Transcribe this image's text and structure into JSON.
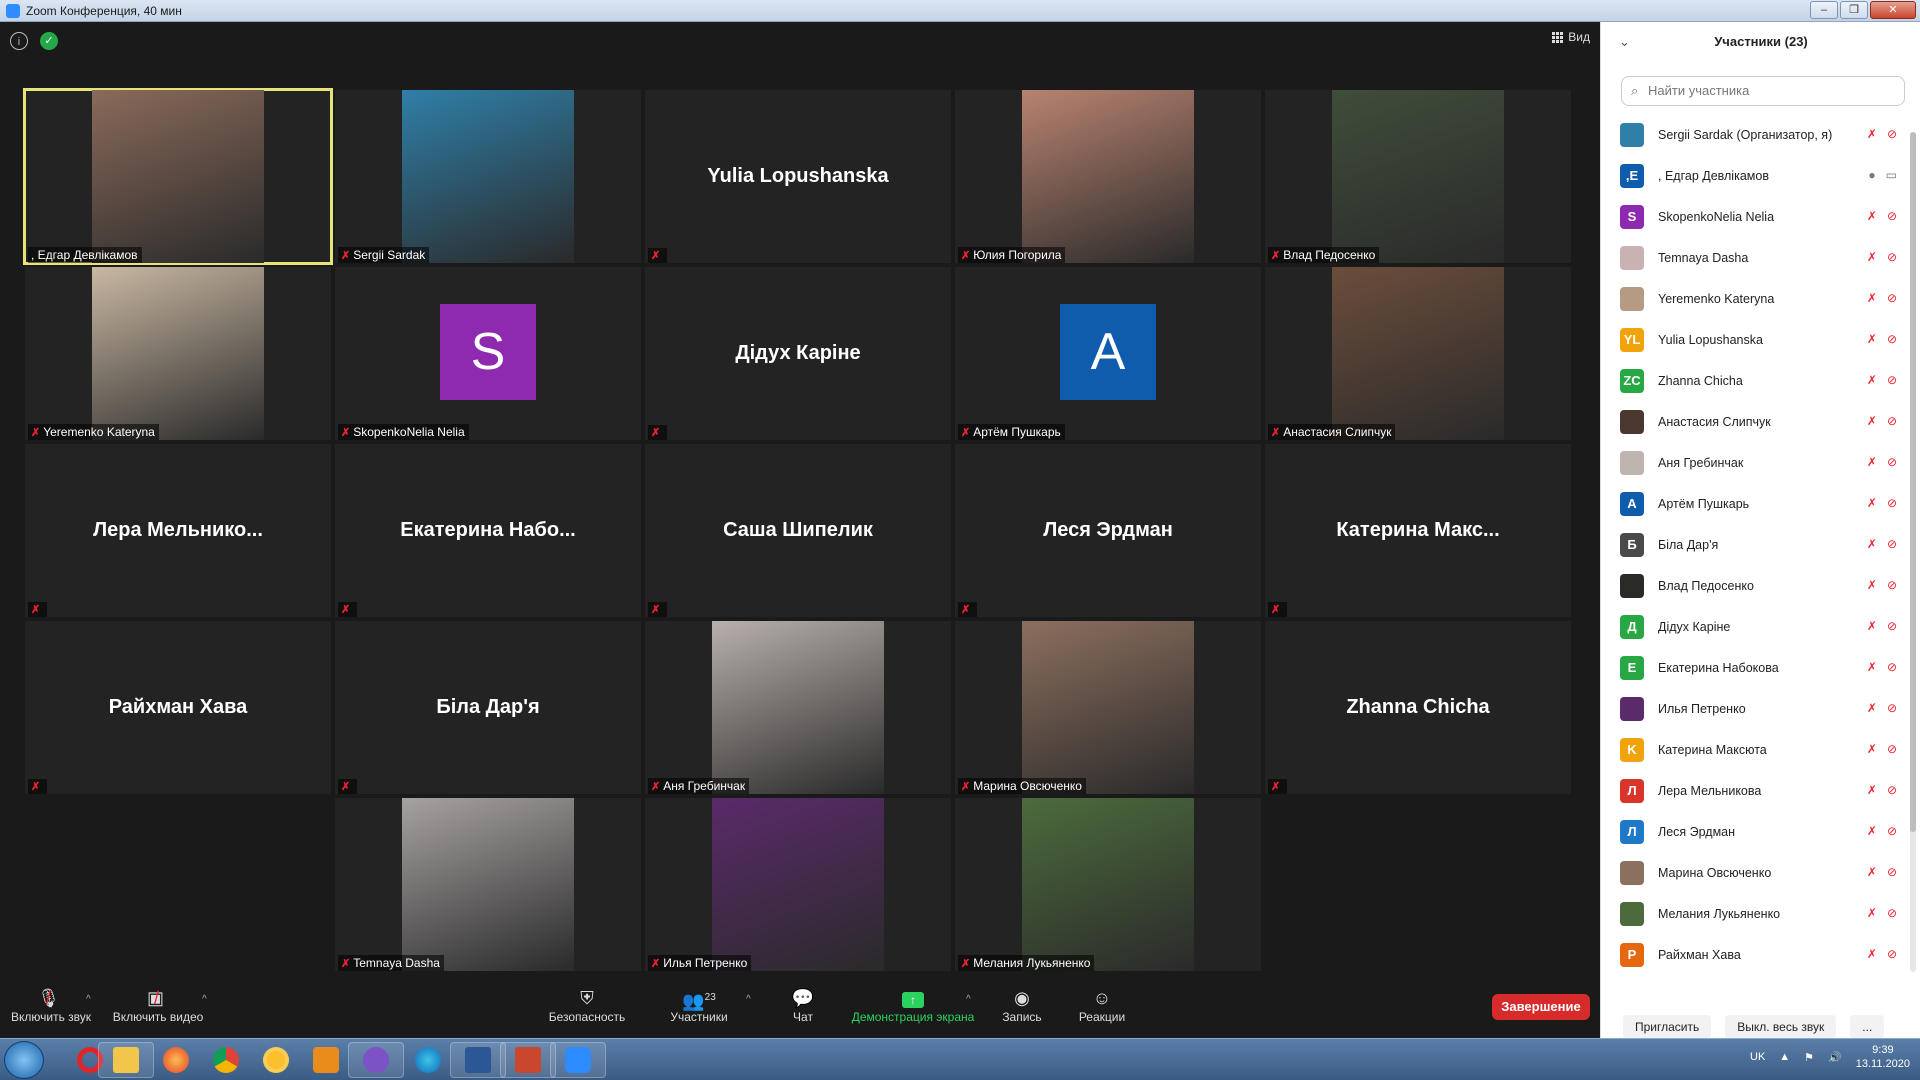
{
  "window": {
    "title": "Zoom Конференция, 40 мин"
  },
  "stage": {
    "view_label": "Вид"
  },
  "tiles": [
    {
      "label": ", Едгар Девлікамов",
      "type": "photo",
      "color": "#8a6a5a",
      "active": true,
      "mic_off": false
    },
    {
      "label": "Sergii Sardak",
      "type": "photo",
      "color": "#2f7fa8"
    },
    {
      "label": "",
      "type": "name",
      "text": "Yulia Lopushanska"
    },
    {
      "label": "Юлия Погорила",
      "type": "photo",
      "color": "#b98370"
    },
    {
      "label": "Влад Педосенко",
      "type": "photo",
      "color": "#3f4d3a"
    },
    {
      "label": "Yeremenko Kateryna",
      "type": "photo",
      "color": "#c9b8a2"
    },
    {
      "label": "SkopenkoNelia Nelia",
      "type": "avatar",
      "text": "S",
      "color": "#8e2ab0"
    },
    {
      "label": "",
      "type": "name",
      "text": "Дідух Каріне"
    },
    {
      "label": "Артём Пушкарь",
      "type": "avatar",
      "text": "A",
      "color": "#0e5cab"
    },
    {
      "label": "Анастасия Слипчук",
      "type": "photo",
      "color": "#6b4d3b"
    },
    {
      "label": "",
      "type": "name",
      "text": "Лера Мельнико..."
    },
    {
      "label": "",
      "type": "name",
      "text": "Екатерина Набо..."
    },
    {
      "label": "",
      "type": "name",
      "text": "Саша Шипелик"
    },
    {
      "label": "",
      "type": "name",
      "text": "Леся Эрдман"
    },
    {
      "label": "",
      "type": "name",
      "text": "Катерина Макс..."
    },
    {
      "label": "",
      "type": "name",
      "text": "Райхман Хава"
    },
    {
      "label": "",
      "type": "name",
      "text": "Біла Дар'я"
    },
    {
      "label": "Аня Гребинчак",
      "type": "photo",
      "color": "#b8b0ac"
    },
    {
      "label": "Марина Овсюченко",
      "type": "photo",
      "color": "#8c6f5e"
    },
    {
      "label": "",
      "type": "name",
      "text": "Zhanna Chicha"
    },
    {
      "label": "Temnaya Dasha",
      "type": "photo",
      "color": "#a7a2a2"
    },
    {
      "label": "Илья Петренко",
      "type": "photo",
      "color": "#5a2a6a"
    },
    {
      "label": "Мелания Лукьяненко",
      "type": "photo",
      "color": "#4c6b3c"
    }
  ],
  "toolbar": {
    "audio": "Включить звук",
    "video": "Включить видео",
    "security": "Безопасность",
    "participants": "Участники",
    "participants_count": "23",
    "chat": "Чат",
    "share": "Демонстрация экрана",
    "record": "Запись",
    "reactions": "Реакции",
    "end": "Завершение"
  },
  "panel": {
    "title": "Участники (23)",
    "search_placeholder": "Найти участника",
    "participants": [
      {
        "name": "Sergii Sardak (Организатор, я)",
        "avatar": "",
        "color": "#2f7fa8",
        "muted": true
      },
      {
        "name": ", Едгар Девлікамов",
        "avatar": ",E",
        "color": "#0e5cab",
        "muted": false
      },
      {
        "name": "SkopenkoNelia Nelia",
        "avatar": "S",
        "color": "#8e2ab0",
        "muted": true
      },
      {
        "name": "Temnaya Dasha",
        "avatar": "",
        "color": "#c9b2b0",
        "muted": true
      },
      {
        "name": "Yeremenko Kateryna",
        "avatar": "",
        "color": "#b59a84",
        "muted": true
      },
      {
        "name": "Yulia Lopushanska",
        "avatar": "YL",
        "color": "#f0a30a",
        "muted": true
      },
      {
        "name": "Zhanna Chicha",
        "avatar": "ZC",
        "color": "#27a844",
        "muted": true
      },
      {
        "name": "Анастасия Слипчук",
        "avatar": "",
        "color": "#4a3830",
        "muted": true
      },
      {
        "name": "Аня Гребинчак",
        "avatar": "",
        "color": "#c0b4b0",
        "muted": true
      },
      {
        "name": "Артём Пушкарь",
        "avatar": "A",
        "color": "#0e5cab",
        "muted": true
      },
      {
        "name": "Біла Дар'я",
        "avatar": "Б",
        "color": "#4a4a4a",
        "muted": true
      },
      {
        "name": "Влад Педосенко",
        "avatar": "",
        "color": "#2c2a26",
        "muted": true
      },
      {
        "name": "Дідух Каріне",
        "avatar": "Д",
        "color": "#27a844",
        "muted": true
      },
      {
        "name": "Екатерина Набокова",
        "avatar": "E",
        "color": "#27a844",
        "muted": true
      },
      {
        "name": "Илья Петренко",
        "avatar": "",
        "color": "#5a2a6a",
        "muted": true
      },
      {
        "name": "Катерина Максюта",
        "avatar": "K",
        "color": "#f0a30a",
        "muted": true
      },
      {
        "name": "Лера Мельникова",
        "avatar": "Л",
        "color": "#d9352a",
        "muted": true
      },
      {
        "name": "Леся Эрдман",
        "avatar": "Л",
        "color": "#1f78c8",
        "muted": true
      },
      {
        "name": "Марина Овсюченко",
        "avatar": "",
        "color": "#8c6f5e",
        "muted": true
      },
      {
        "name": "Мелания Лукьяненко",
        "avatar": "",
        "color": "#4c6b3c",
        "muted": true
      },
      {
        "name": "Райхман Хава",
        "avatar": "P",
        "color": "#e6680e",
        "muted": true
      }
    ],
    "invite": "Пригласить",
    "mute_all": "Выкл. весь звук",
    "more": "..."
  },
  "taskbar": {
    "lang": "UK",
    "time": "9:39",
    "date": "13.11.2020"
  }
}
